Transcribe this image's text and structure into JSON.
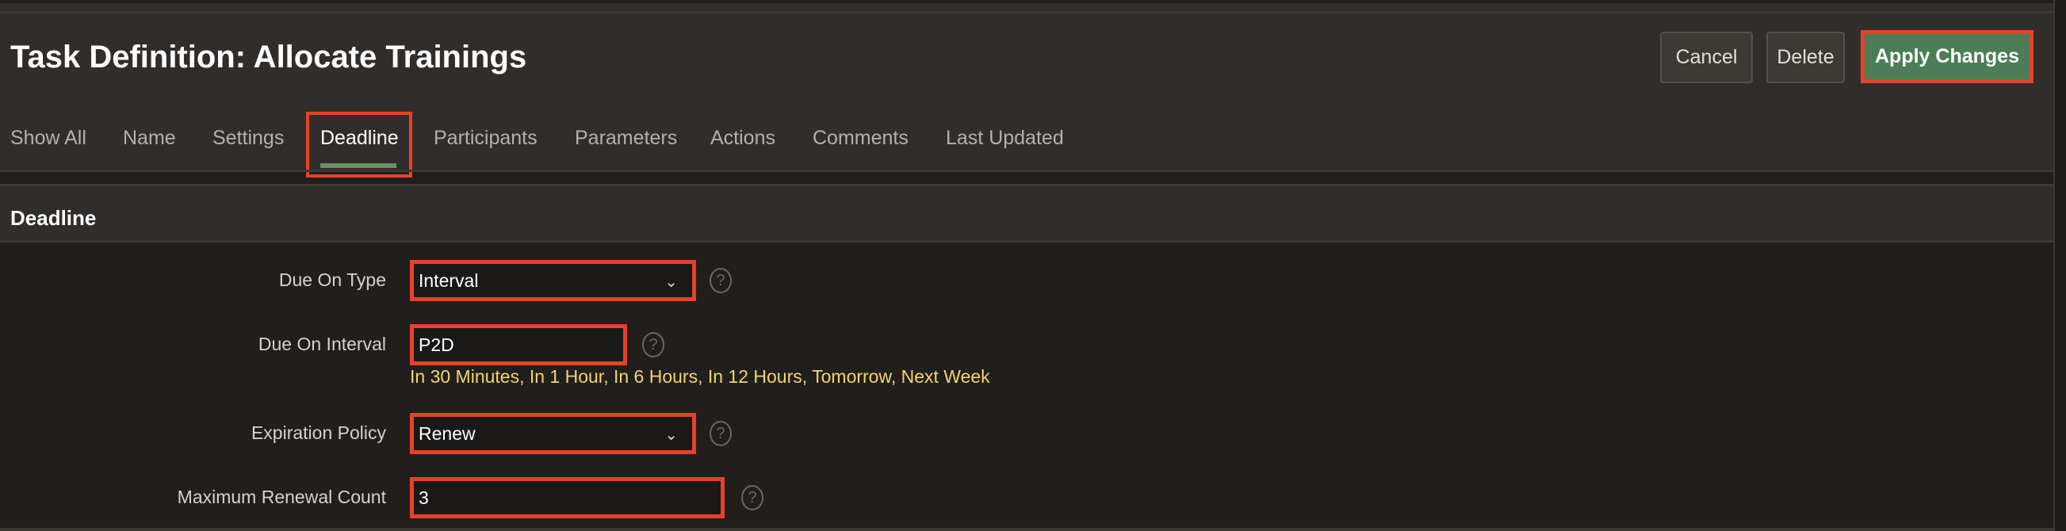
{
  "header": {
    "title": "Task Definition: Allocate Trainings",
    "buttons": {
      "cancel": "Cancel",
      "delete": "Delete",
      "apply": "Apply Changes"
    }
  },
  "tabs": [
    {
      "label": "Show All"
    },
    {
      "label": "Name"
    },
    {
      "label": "Settings"
    },
    {
      "label": "Deadline",
      "active": true
    },
    {
      "label": "Participants"
    },
    {
      "label": "Parameters"
    },
    {
      "label": "Actions"
    },
    {
      "label": "Comments"
    },
    {
      "label": "Last Updated"
    }
  ],
  "section": {
    "title": "Deadline"
  },
  "form": {
    "due_on_type": {
      "label": "Due On Type",
      "value": "Interval"
    },
    "due_on_interval": {
      "label": "Due On Interval",
      "value": "P2D",
      "hint": "In 30 Minutes, In 1 Hour, In 6 Hours, In 12 Hours, Tomorrow, Next Week"
    },
    "expiration_policy": {
      "label": "Expiration Policy",
      "value": "Renew"
    },
    "max_renewal_count": {
      "label": "Maximum Renewal Count",
      "value": "3"
    }
  },
  "icons": {
    "help": "?",
    "chevron": "⌄"
  },
  "colors": {
    "accent": "#4b7d57",
    "highlight": "#e8402a",
    "hint": "#f5d36e",
    "tab_underline": "#6f8f64"
  }
}
